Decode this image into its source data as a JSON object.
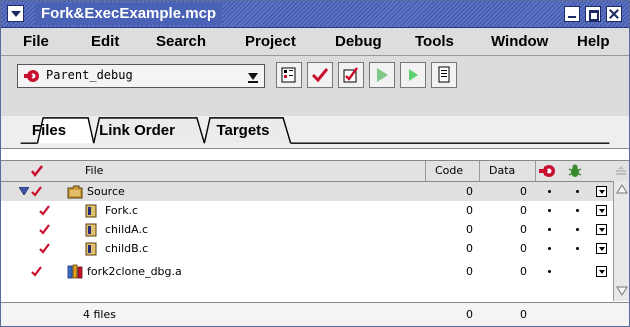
{
  "window": {
    "title": "Fork&ExecExample.mcp"
  },
  "menubar": {
    "items": [
      "File",
      "Edit",
      "Search",
      "Project",
      "Debug",
      "Tools",
      "Window",
      "Help"
    ]
  },
  "toolbar": {
    "target": "Parent_debug"
  },
  "tabs": [
    {
      "label": "Files",
      "active": true
    },
    {
      "label": "Link Order",
      "active": false
    },
    {
      "label": "Targets",
      "active": false
    }
  ],
  "table": {
    "headers": {
      "file": "File",
      "code": "Code",
      "data": "Data"
    },
    "rows": [
      {
        "name": "Source",
        "code": "0",
        "data": "0",
        "type": "group",
        "debug": true,
        "target": true,
        "selected": true
      },
      {
        "name": "Fork.c",
        "code": "0",
        "data": "0",
        "type": "file",
        "debug": true,
        "target": true
      },
      {
        "name": "childA.c",
        "code": "0",
        "data": "0",
        "type": "file",
        "debug": true,
        "target": true
      },
      {
        "name": "childB.c",
        "code": "0",
        "data": "0",
        "type": "file",
        "debug": true,
        "target": true
      },
      {
        "name": "fork2clone_dbg.a",
        "code": "0",
        "data": "0",
        "type": "lib",
        "debug": true,
        "target": false
      }
    ]
  },
  "status": {
    "files": "4 files",
    "code_total": "0",
    "data_total": "0"
  },
  "colors": {
    "titlebar": "#4a62b6",
    "check": "#c8102e"
  }
}
